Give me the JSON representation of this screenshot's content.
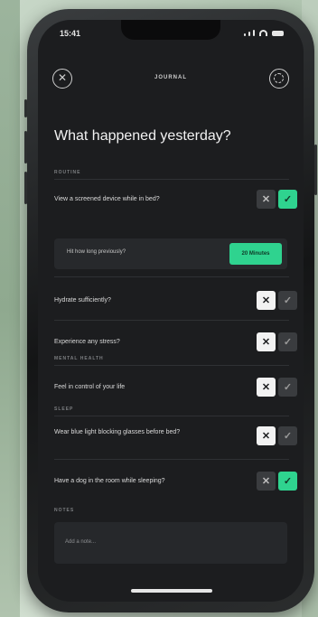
{
  "status_bar": {
    "time": "15:41"
  },
  "header": {
    "title": "JOURNAL"
  },
  "page": {
    "title": "What happened yesterday?"
  },
  "sections": {
    "routine": "ROUTINE",
    "mental_health": "MENTAL HEALTH",
    "sleep": "SLEEP",
    "notes": "NOTES"
  },
  "questions": [
    {
      "text": "View a screened device while in bed?",
      "answer": "yes"
    },
    {
      "text": "Hydrate sufficiently?",
      "answer": "no"
    },
    {
      "text": "Experience any stress?",
      "answer": "no"
    },
    {
      "text": "Feel in control of your life",
      "answer": "no"
    },
    {
      "text": "Wear blue light blocking glasses before bed?",
      "answer": "no"
    },
    {
      "text": "Have a dog in the room while sleeping?",
      "answer": "yes"
    }
  ],
  "sub_question": {
    "text": "Hit how long previously?",
    "button": "20 Minutes"
  },
  "notes": {
    "placeholder": "Add a note..."
  },
  "glyphs": {
    "x": "✕",
    "check": "✓"
  },
  "colors": {
    "accent": "#2fd38f",
    "background": "#1c1d1f"
  }
}
